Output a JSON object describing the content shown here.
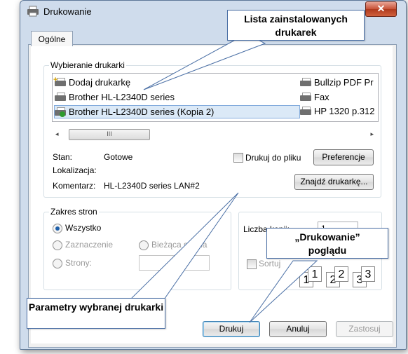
{
  "window": {
    "title": "Drukowanie",
    "close_glyph": "✕"
  },
  "tabs": [
    {
      "label": "Ogólne"
    }
  ],
  "printer_select": {
    "legend": "Wybieranie drukarki",
    "printers": [
      {
        "name": "Dodaj drukarkę",
        "icon": "add-printer-icon"
      },
      {
        "name": "Brother HL-L2340D series",
        "icon": "printer-icon"
      },
      {
        "name": "Brother HL-L2340D series (Kopia 2)",
        "icon": "default-printer-icon",
        "selected": true
      },
      {
        "name": "Bullzip PDF Pr",
        "icon": "printer-icon"
      },
      {
        "name": "Fax",
        "icon": "fax-icon"
      },
      {
        "name": "HP 1320 p.312",
        "icon": "network-printer-icon"
      }
    ],
    "scroll": {
      "left": "◂",
      "right": "▸",
      "thumb": "III"
    },
    "status_label": "Stan:",
    "status_value": "Gotowe",
    "location_label": "Lokalizacja:",
    "location_value": "",
    "comment_label": "Komentarz:",
    "comment_value": "HL-L2340D series LAN#2",
    "print_to_file": "Drukuj do pliku",
    "preferences_button": "Preferencje",
    "find_printer_button": "Znajdź drukarkę..."
  },
  "page_range": {
    "legend": "Zakres stron",
    "all": "Wszystko",
    "selection": "Zaznaczenie",
    "current_page": "Bieżąca strona",
    "pages": "Strony:",
    "selected": "all"
  },
  "copies": {
    "count_label": "Liczba kopii:",
    "count_value": "1",
    "collate_label": "Sortuj",
    "collate_pages": [
      "1",
      "1",
      "2",
      "2",
      "3",
      "3"
    ]
  },
  "buttons": {
    "print": "Drukuj",
    "cancel": "Anuluj",
    "apply": "Zastosuj"
  },
  "callouts": {
    "installed_printers": "Lista zainstalowanych drukarek",
    "printer_params": "Parametry wybranej drukarki",
    "print_preview": "„Drukowanie” poglądu"
  },
  "colors": {
    "window_frame": "#cfdcec",
    "selection": "#dbe9f7",
    "callout_border": "#4a6fa5",
    "close_button": "#c75237"
  }
}
